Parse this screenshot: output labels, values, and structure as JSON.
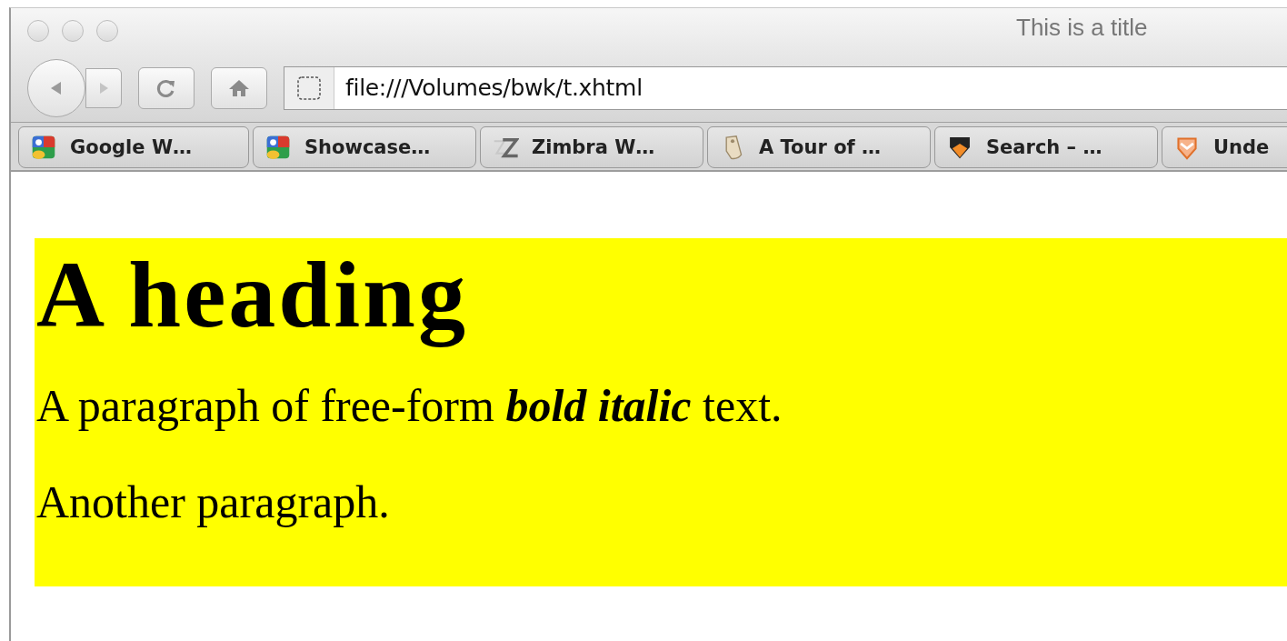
{
  "window": {
    "title": "This is a title"
  },
  "toolbar": {
    "address": "file:///Volumes/bwk/t.xhtml"
  },
  "bookmarks": [
    {
      "label": "Google W…",
      "kind": "google"
    },
    {
      "label": "Showcase…",
      "kind": "google"
    },
    {
      "label": "Zimbra W…",
      "kind": "zimbra"
    },
    {
      "label": "A Tour of …",
      "kind": "tag"
    },
    {
      "label": "Search – …",
      "kind": "shield"
    },
    {
      "label": "Unde",
      "kind": "crest"
    }
  ],
  "page": {
    "heading": "A heading",
    "paragraphs": [
      "A paragraph of free-form **bold italic** text.",
      "Another paragraph."
    ]
  }
}
